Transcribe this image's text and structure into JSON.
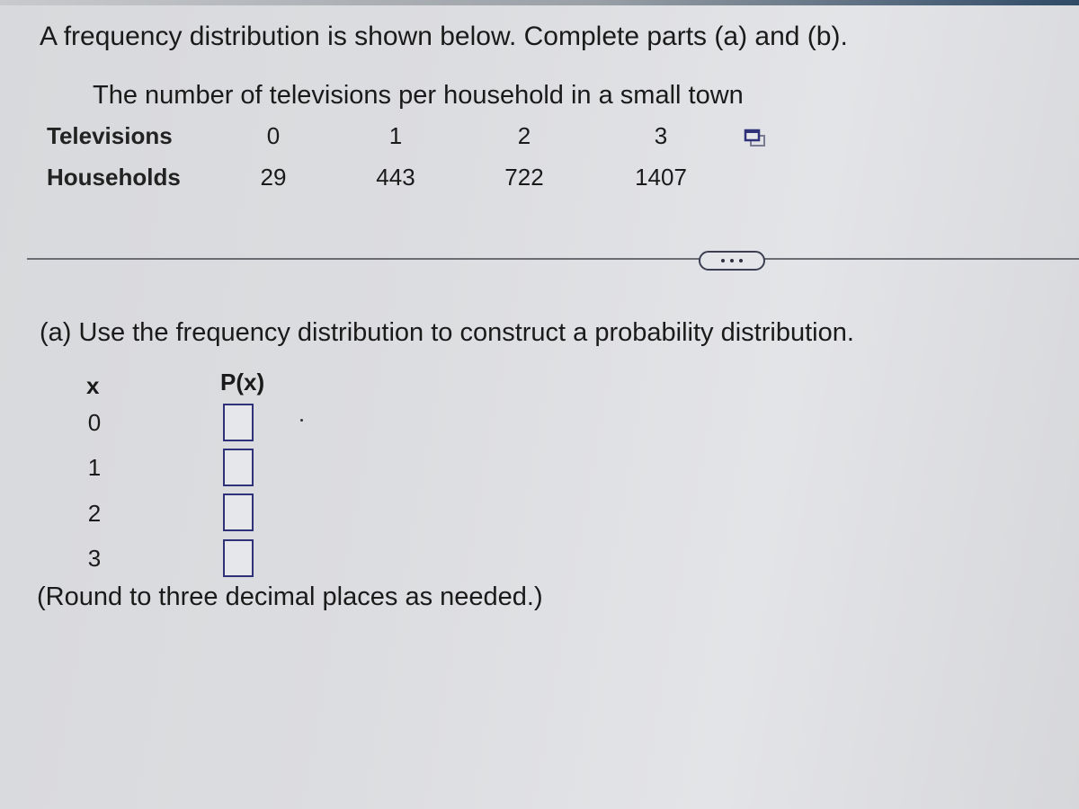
{
  "question": {
    "intro": "A frequency distribution is shown below. Complete parts (a) and (b).",
    "table_caption": "The number of televisions per household in a small town",
    "row_labels": [
      "Televisions",
      "Households"
    ],
    "televisions": [
      "0",
      "1",
      "2",
      "3"
    ],
    "households": [
      "29",
      "443",
      "722",
      "1407"
    ],
    "copy_icon": "copy-table-icon"
  },
  "divider": {
    "more_button_icon": "ellipsis-icon"
  },
  "part_a": {
    "prompt": "(a) Use the frequency distribution to construct a probability distribution.",
    "col_x": "x",
    "col_px": "P(x)",
    "rows": [
      {
        "x": "0",
        "px_value": ""
      },
      {
        "x": "1",
        "px_value": ""
      },
      {
        "x": "2",
        "px_value": ""
      },
      {
        "x": "3",
        "px_value": ""
      }
    ],
    "note": "(Round to three decimal places as needed.)"
  },
  "colors": {
    "input_border": "#2f3179",
    "text": "#1a1a1a"
  }
}
